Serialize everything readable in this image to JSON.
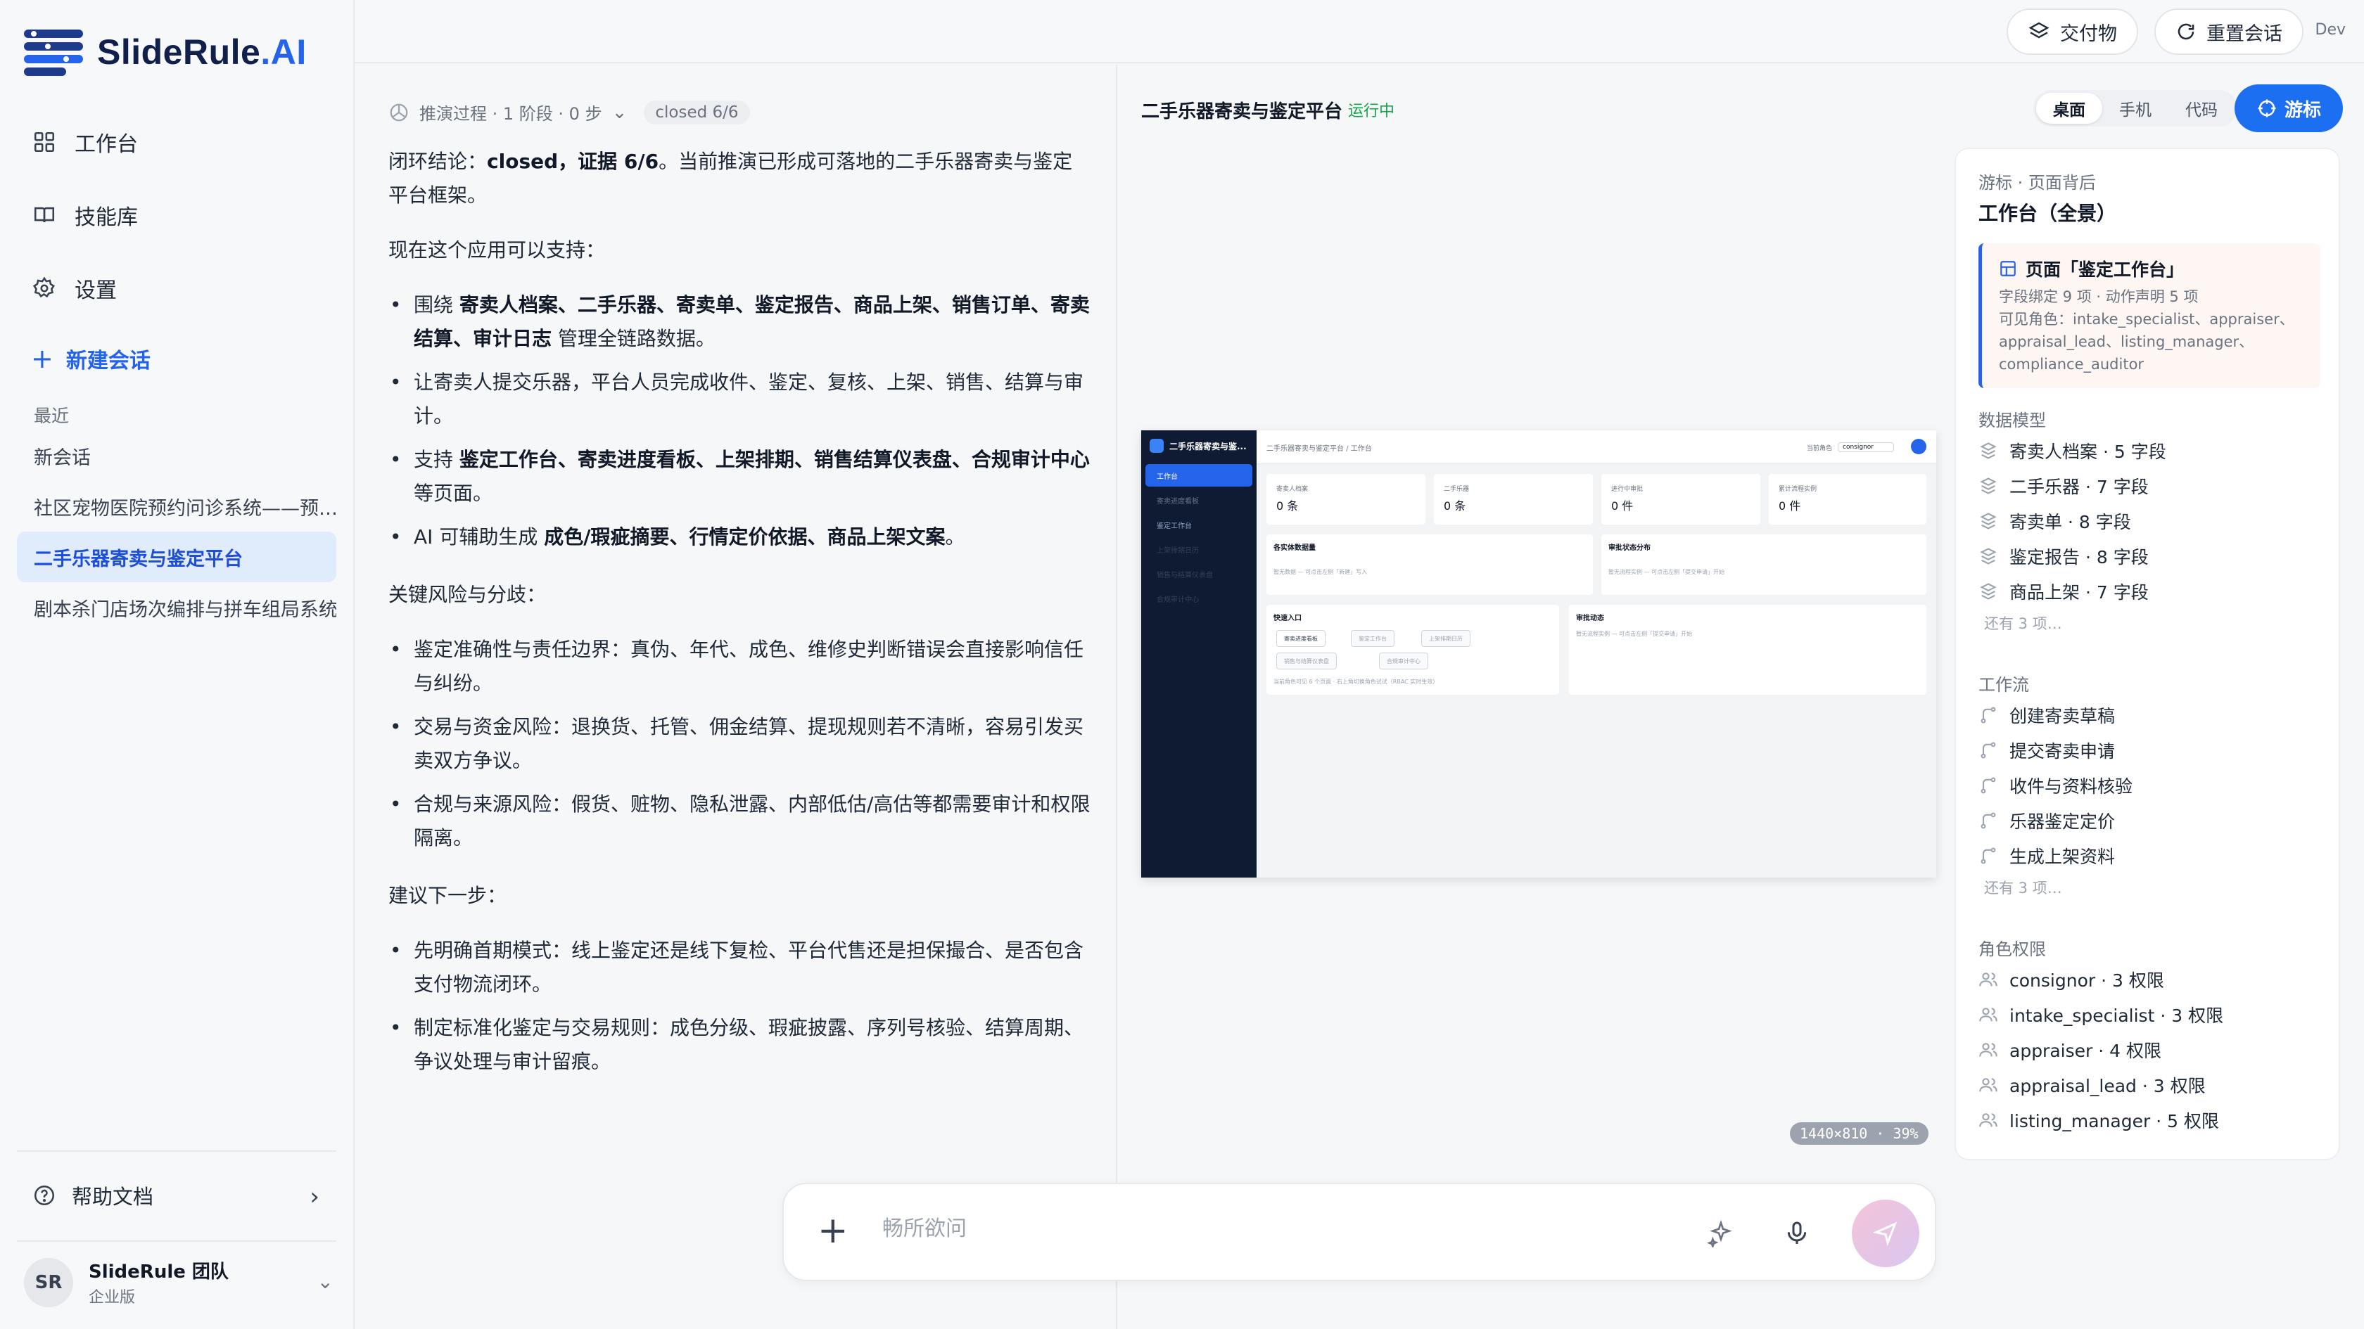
{
  "app": {
    "logo_text_main": "SlideRule",
    "logo_text_accent": ".AI",
    "colors": {
      "accent": "#2563eb",
      "active_bg": "#e0ebfb",
      "running": "#16a34a"
    }
  },
  "sidebar": {
    "nav": [
      {
        "label": "工作台",
        "icon": "grid-icon"
      },
      {
        "label": "技能库",
        "icon": "book-icon"
      },
      {
        "label": "设置",
        "icon": "gear-icon"
      }
    ],
    "new_chat": "新建会话",
    "recent_label": "最近",
    "recent": [
      {
        "label": "新会话",
        "active": false
      },
      {
        "label": "社区宠物医院预约问诊系统——预…",
        "active": false
      },
      {
        "label": "二手乐器寄卖与鉴定平台",
        "active": true
      },
      {
        "label": "剧本杀门店场次编排与拼车组局系统",
        "active": false
      }
    ],
    "help": "帮助文档",
    "team": {
      "initials": "SR",
      "name": "SlideRule 团队",
      "plan": "企业版"
    }
  },
  "topbar": {
    "deliverables": "交付物",
    "reset": "重置会话",
    "dev": "Dev"
  },
  "chat": {
    "reasoning": "推演过程 · 1 阶段 · 0 步",
    "closed_badge": "closed 6/6",
    "conclusion_prefix": "闭环结论：",
    "conclusion_bold": "closed，证据 6/6",
    "conclusion_suffix": "。当前推演已形成可落地的二手乐器寄卖与鉴定平台框架。",
    "support_heading": "现在这个应用可以支持：",
    "support": [
      {
        "pre": "围绕 ",
        "bold": "寄卖人档案、二手乐器、寄卖单、鉴定报告、商品上架、销售订单、寄卖结算、审计日志",
        "post": " 管理全链路数据。"
      },
      {
        "pre": "让寄卖人提交乐器，平台人员完成收件、鉴定、复核、上架、销售、结算与审计。",
        "bold": "",
        "post": ""
      },
      {
        "pre": "支持 ",
        "bold": "鉴定工作台、寄卖进度看板、上架排期、销售结算仪表盘、合规审计中心",
        "post": " 等页面。"
      },
      {
        "pre": "AI 可辅助生成 ",
        "bold": "成色/瑕疵摘要、行情定价依据、商品上架文案",
        "post": "。"
      }
    ],
    "risk_heading": "关键风险与分歧：",
    "risks": [
      "鉴定准确性与责任边界：真伪、年代、成色、维修史判断错误会直接影响信任与纠纷。",
      "交易与资金风险：退换货、托管、佣金结算、提现规则若不清晰，容易引发买卖双方争议。",
      "合规与来源风险：假货、赃物、隐私泄露、内部低估/高估等都需要审计和权限隔离。"
    ],
    "next_heading": "建议下一步：",
    "next": [
      "先明确首期模式：线上鉴定还是线下复检、平台代售还是担保撮合、是否包含支付物流闭环。",
      "制定标准化鉴定与交易规则：成色分级、瑕疵披露、序列号核验、结算周期、争议处理与审计留痕。"
    ]
  },
  "preview": {
    "title": "二手乐器寄卖与鉴定平台",
    "status": "运行中",
    "segments": [
      "桌面",
      "手机",
      "代码"
    ],
    "cursor_button": "游标",
    "zoom_tag": "1440×810 · 39%",
    "mini": {
      "brand": "二手乐器寄卖与鉴...",
      "nav": [
        "工作台",
        "寄卖进度看板",
        "鉴定工作台",
        "上架排期日历",
        "销售与结算仪表盘",
        "合规审计中心"
      ],
      "crumb": "二手乐器寄卖与鉴定平台 / 工作台",
      "role_label": "当前角色",
      "role_value": "consignor",
      "stats": [
        {
          "label": "寄卖人档案",
          "value": "0 条"
        },
        {
          "label": "二手乐器",
          "value": "0 条"
        },
        {
          "label": "进行中审批",
          "value": "0 件"
        },
        {
          "label": "累计流程实例",
          "value": "0 件"
        }
      ],
      "panels": [
        {
          "title": "各实体数据量",
          "desc": "暂无数据 — 可点击左侧「新建」写入"
        },
        {
          "title": "审批状态分布",
          "desc": "暂无流程实例 — 可点击左侧「提交申请」开始"
        },
        {
          "title": "快速入口",
          "desc": "当前角色可见 6 个页面 · 右上角切换角色试试（RBAC 实时生效）"
        },
        {
          "title": "审批动态",
          "desc": "暂无流程实例 — 可点击左侧「提交申请」开始"
        }
      ],
      "quick": [
        "寄卖进度看板",
        "鉴定工作台",
        "上架排期日历",
        "销售与结算仪表盘",
        "合规审计中心"
      ]
    }
  },
  "inspector": {
    "head": "游标 · 页面背后",
    "title": "工作台（全景）",
    "page": {
      "title": "页面「鉴定工作台」",
      "fields": "字段绑定 9 项 · 动作声明 5 项",
      "roles": "可见角色：intake_specialist、appraiser、appraisal_lead、listing_manager、compliance_auditor"
    },
    "data_model_label": "数据模型",
    "data_model": [
      "寄卖人档案 · 5 字段",
      "二手乐器 · 7 字段",
      "寄卖单 · 8 字段",
      "鉴定报告 · 8 字段",
      "商品上架 · 7 字段"
    ],
    "data_model_more": "还有 3 项…",
    "workflow_label": "工作流",
    "workflow": [
      "创建寄卖草稿",
      "提交寄卖申请",
      "收件与资料核验",
      "乐器鉴定定价",
      "生成上架资料"
    ],
    "workflow_more": "还有 3 项…",
    "roles_label": "角色权限",
    "roles": [
      "consignor · 3 权限",
      "intake_specialist · 3 权限",
      "appraiser · 4 权限",
      "appraisal_lead · 3 权限",
      "listing_manager · 5 权限"
    ]
  },
  "composer": {
    "placeholder": "畅所欲问"
  }
}
